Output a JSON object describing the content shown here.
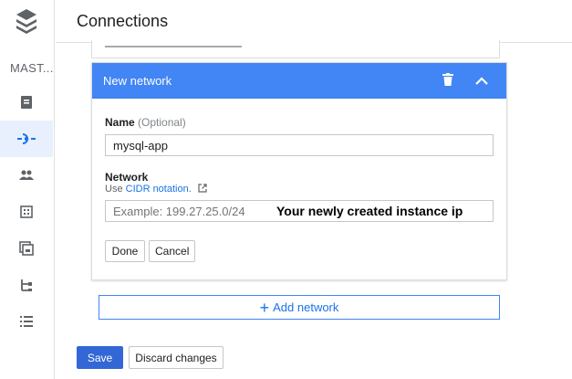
{
  "header": {
    "title": "Connections"
  },
  "sidebar": {
    "project_label": "MAST...",
    "items": [
      {
        "icon": "instance-icon"
      },
      {
        "icon": "connections-icon",
        "active": true
      },
      {
        "icon": "users-icon"
      },
      {
        "icon": "databases-icon"
      },
      {
        "icon": "backups-icon"
      },
      {
        "icon": "replicas-icon"
      },
      {
        "icon": "operations-icon"
      }
    ]
  },
  "network_card": {
    "header_label": "New network",
    "name_label": "Name",
    "name_optional": "(Optional)",
    "name_value": "mysql-app",
    "network_label": "Network",
    "hint_prefix": "Use",
    "hint_link": "CIDR notation.",
    "network_placeholder": "Example: 199.27.25.0/24",
    "annotation": "Your newly created instance ip",
    "done_label": "Done",
    "cancel_label": "Cancel"
  },
  "add_network_label": "Add network",
  "footer": {
    "save_label": "Save",
    "discard_label": "Discard changes"
  },
  "colors": {
    "accent": "#4285f4",
    "primary_button": "#3367d6",
    "link": "#1a73e8"
  }
}
